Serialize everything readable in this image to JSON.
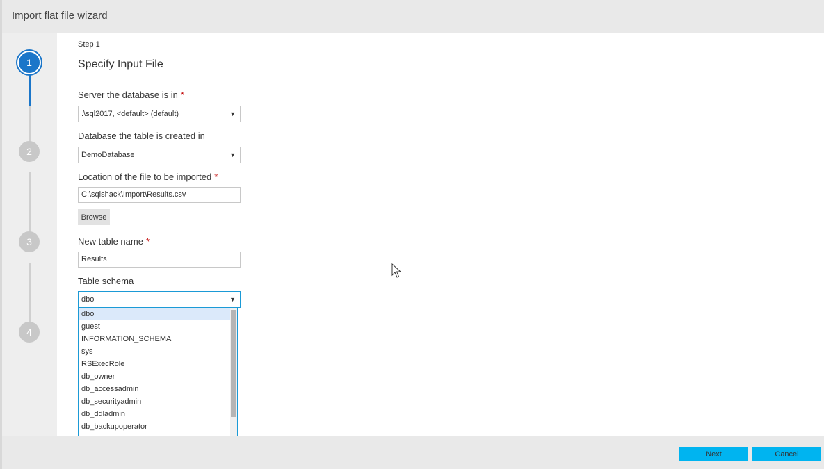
{
  "window": {
    "title": "Import flat file wizard"
  },
  "stepper": {
    "steps": [
      "1",
      "2",
      "3",
      "4"
    ],
    "active": 1
  },
  "page": {
    "step_label": "Step 1",
    "heading": "Specify Input File"
  },
  "fields": {
    "server": {
      "label": "Server the database is in",
      "required": "*",
      "value": ".\\sql2017, <default> (default)"
    },
    "database": {
      "label": "Database the table is created in",
      "value": "DemoDatabase"
    },
    "file_location": {
      "label": "Location of the file to be imported",
      "required": "*",
      "value": "C:\\sqlshack\\Import\\Results.csv"
    },
    "browse_label": "Browse",
    "table_name": {
      "label": "New table name",
      "required": "*",
      "value": "Results"
    },
    "schema": {
      "label": "Table schema",
      "value": "dbo",
      "options": [
        "dbo",
        "guest",
        "INFORMATION_SCHEMA",
        "sys",
        "RSExecRole",
        "db_owner",
        "db_accessadmin",
        "db_securityadmin",
        "db_ddladmin",
        "db_backupoperator",
        "db_datareader"
      ]
    }
  },
  "footer": {
    "next_label": "Next",
    "cancel_label": "Cancel"
  },
  "icons": {
    "dropdown": "chevron-down-icon",
    "cursor": "mouse-pointer-icon"
  },
  "colors": {
    "accent": "#1b76c9",
    "primary_button": "#00b4f0",
    "required": "#c00000"
  }
}
